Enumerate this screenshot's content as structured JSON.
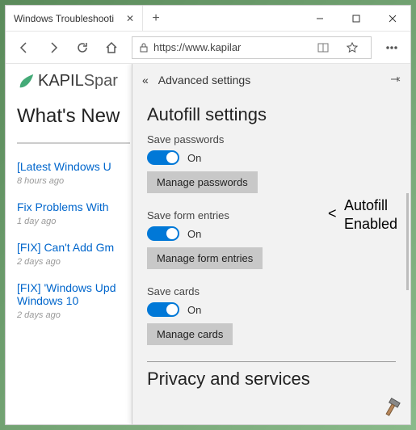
{
  "window": {
    "tab_title": "Windows Troubleshooti",
    "url": "https://www.kapilar"
  },
  "page": {
    "logo_bold": "KAPIL",
    "logo_light": "Spar",
    "heading": "What's New",
    "news": [
      {
        "title": "[Latest Windows U",
        "time": "8 hours ago"
      },
      {
        "title": "Fix Problems With",
        "time": "1 day ago"
      },
      {
        "title": "[FIX] Can't Add Gm",
        "time": "2 days ago"
      },
      {
        "title": "[FIX] 'Windows Upd",
        "title2": "Windows 10",
        "time": "2 days ago"
      }
    ]
  },
  "panel": {
    "title": "Advanced settings",
    "section1": "Autofill settings",
    "save_passwords_label": "Save passwords",
    "on1": "On",
    "manage_passwords": "Manage passwords",
    "save_form_label": "Save form entries",
    "on2": "On",
    "manage_form": "Manage form entries",
    "save_cards_label": "Save cards",
    "on3": "On",
    "manage_cards": "Manage cards",
    "section2": "Privacy and services"
  },
  "annotation": {
    "line1": "Autofill",
    "line2": "Enabled"
  }
}
